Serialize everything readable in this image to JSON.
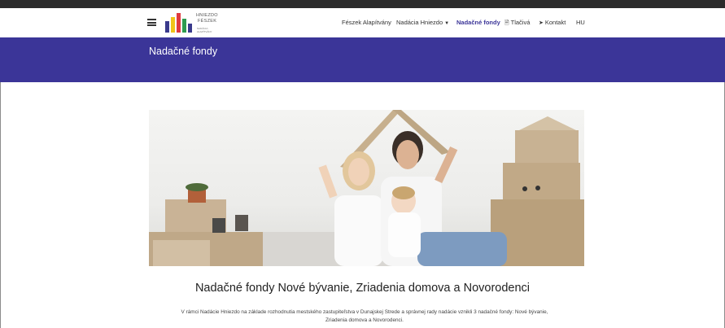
{
  "header": {
    "logo_text_line1": "HNIEZDO",
    "logo_text_line2": "FÉSZEK",
    "logo_text_line3": "NADÁCIA · ALAPÍTVÁNY"
  },
  "nav": {
    "items": [
      {
        "label": "Fészek Alapítvány"
      },
      {
        "label": "Nadácia Hniezdo",
        "icon": "chevron-down"
      },
      {
        "label": "Nadačné fondy",
        "active": true
      },
      {
        "label": "Tlačivá",
        "icon": "document"
      },
      {
        "label": "Kontakt",
        "icon": "paper-plane"
      },
      {
        "label": "HU"
      }
    ]
  },
  "banner": {
    "title": "Nadačné fondy"
  },
  "content": {
    "headline": "Nadačné fondy Nové bývanie, Zriadenia domova a Novorodenci",
    "paragraph_line1": "V rámci Nadácie Hniezdo na základe rozhodnutia mestského zastupiteľstva v Dunajskej Strede a správnej rady nadácie vznikli 3 nadačné fondy: Nové bývanie,",
    "paragraph_line2": "Zriadenia domova a Novorodenci."
  },
  "colors": {
    "brand": "#3b3598",
    "topbar": "#2b2b2b",
    "background": "#ffffff"
  }
}
